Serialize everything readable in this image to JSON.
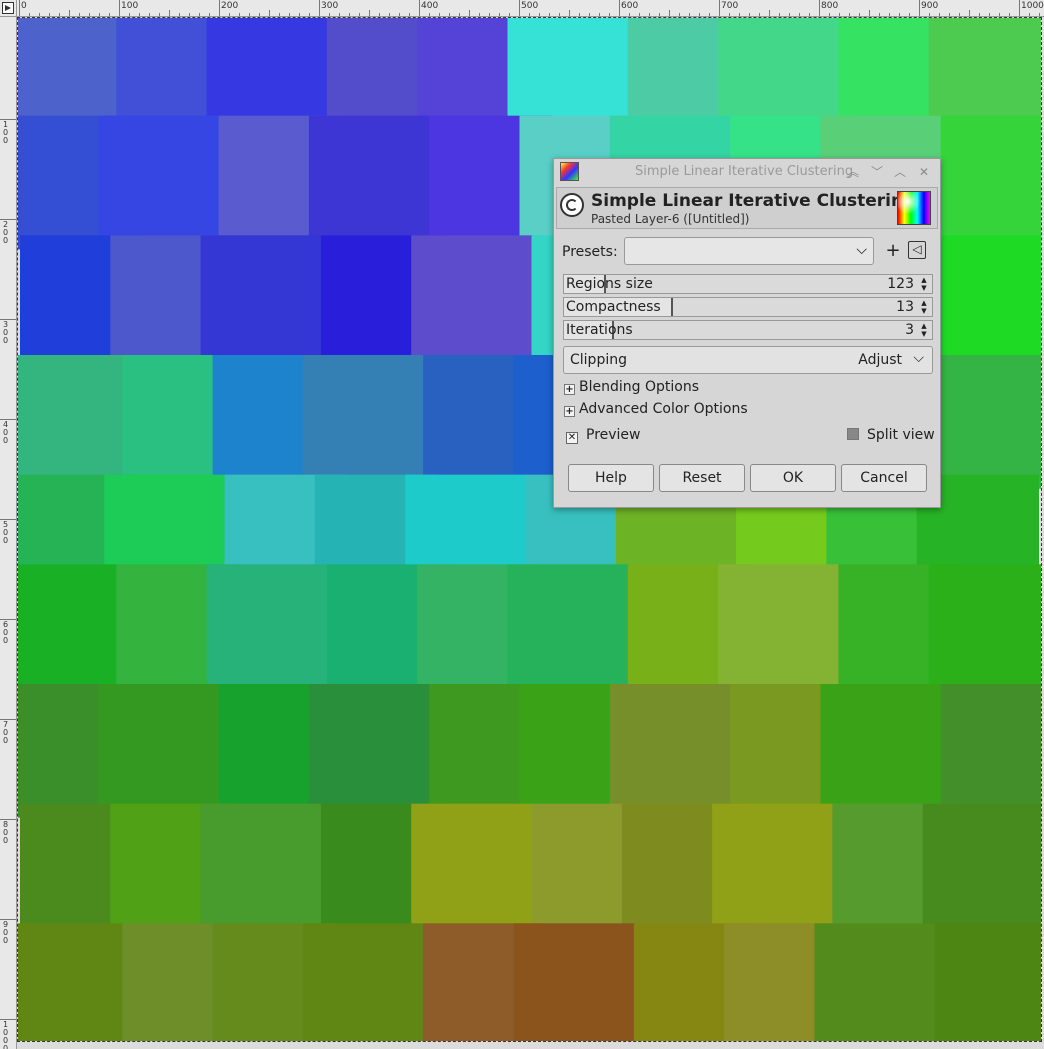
{
  "ruler": {
    "h_ticks": [
      "0",
      "100",
      "200",
      "300",
      "400",
      "500",
      "600",
      "700",
      "800",
      "900",
      "1000"
    ],
    "v_ticks": [
      "100",
      "200",
      "300",
      "400",
      "500",
      "600",
      "700",
      "800",
      "900",
      "1000"
    ]
  },
  "dialog": {
    "window_title": "Simple Linear Iterative Clustering",
    "header_title": "Simple Linear Iterative Clustering",
    "header_subtitle": "Pasted Layer-6 ([Untitled])",
    "presets_label": "Presets:",
    "presets_value": "",
    "params": [
      {
        "label": "Regions size",
        "value": "123",
        "fill": 0.11
      },
      {
        "label": "Compactness",
        "value": "13",
        "fill": 0.29
      },
      {
        "label": "Iterations",
        "value": "3",
        "fill": 0.13
      }
    ],
    "clipping_label": "Clipping",
    "clipping_value": "Adjust",
    "blending_label": "Blending Options",
    "advanced_label": "Advanced Color Options",
    "preview_label": "Preview",
    "preview_checked": true,
    "split_label": "Split view",
    "split_checked": false,
    "buttons": {
      "help": "Help",
      "reset": "Reset",
      "ok": "OK",
      "cancel": "Cancel"
    }
  }
}
